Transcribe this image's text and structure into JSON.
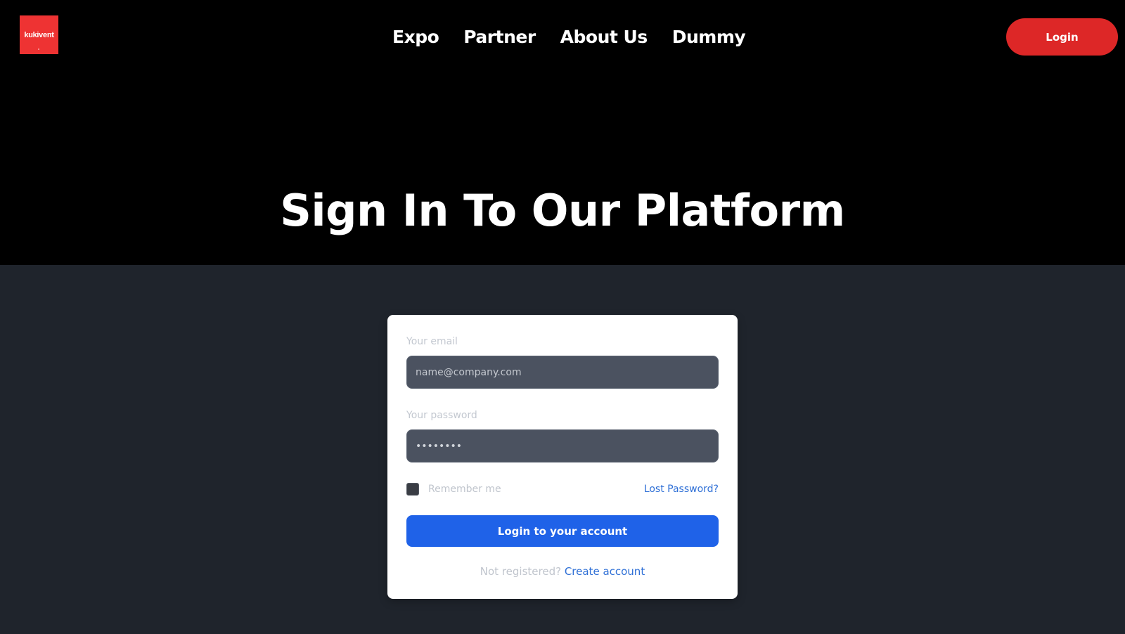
{
  "brand": {
    "logo_text": "kukivent",
    "logo_color": "#ee3333"
  },
  "nav": {
    "links": [
      "Expo",
      "Partner",
      "About Us",
      "Dummy"
    ],
    "login_label": "Login",
    "login_color": "#dd2727"
  },
  "hero": {
    "title": "Sign In To Our Platform"
  },
  "form": {
    "email_label": "Your email",
    "email_placeholder": "name@company.com",
    "password_label": "Your password",
    "password_value": "••••••••",
    "remember_label": "Remember me",
    "lost_password_label": "Lost Password?",
    "submit_label": "Login to your account",
    "submit_color": "#1f62e8",
    "not_registered_text": "Not registered?",
    "create_account_label": "Create account"
  },
  "colors": {
    "hero_bg": "#000000",
    "page_bg": "#1f242c",
    "link": "#2e6fd6"
  }
}
